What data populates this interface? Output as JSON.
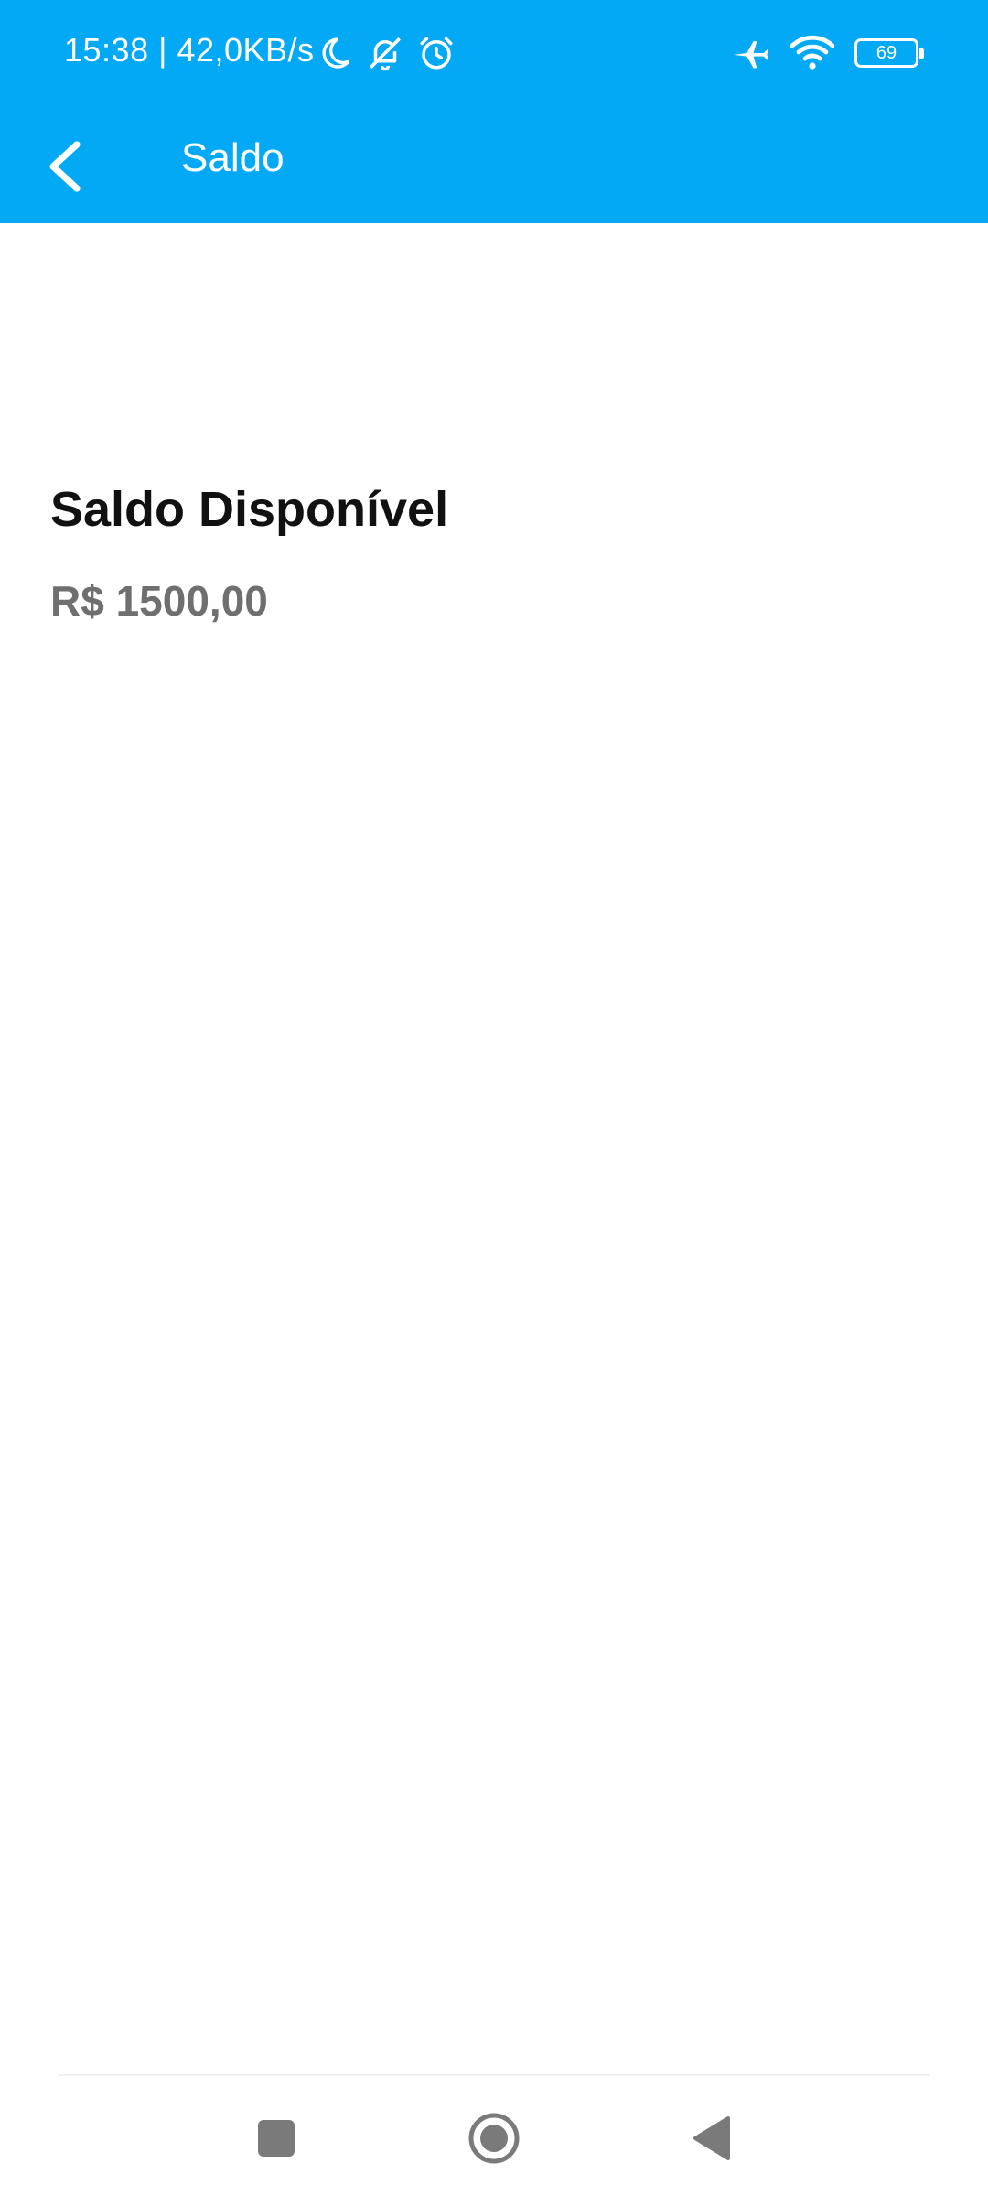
{
  "status_bar": {
    "time_and_speed": "15:38 | 42,0KB/s",
    "left_icons": [
      "moon-icon",
      "bell-off-icon",
      "alarm-icon"
    ],
    "right_icons": [
      "airplane-icon",
      "wifi-icon",
      "battery-icon"
    ],
    "battery_level": "69"
  },
  "toolbar": {
    "title": "Saldo",
    "back_icon": "chevron-left-icon"
  },
  "content": {
    "balance_label": "Saldo Disponível",
    "balance_value": "R$ 1500,00"
  },
  "nav_bar": {
    "buttons": [
      "recents-icon",
      "home-icon",
      "back-triangle-icon"
    ]
  },
  "colors": {
    "appbar": "#03A9F4",
    "background": "#FFFFFF",
    "label_text": "#111111",
    "value_text": "#6F6F6F",
    "nav_icons": "#7A7A7A"
  }
}
